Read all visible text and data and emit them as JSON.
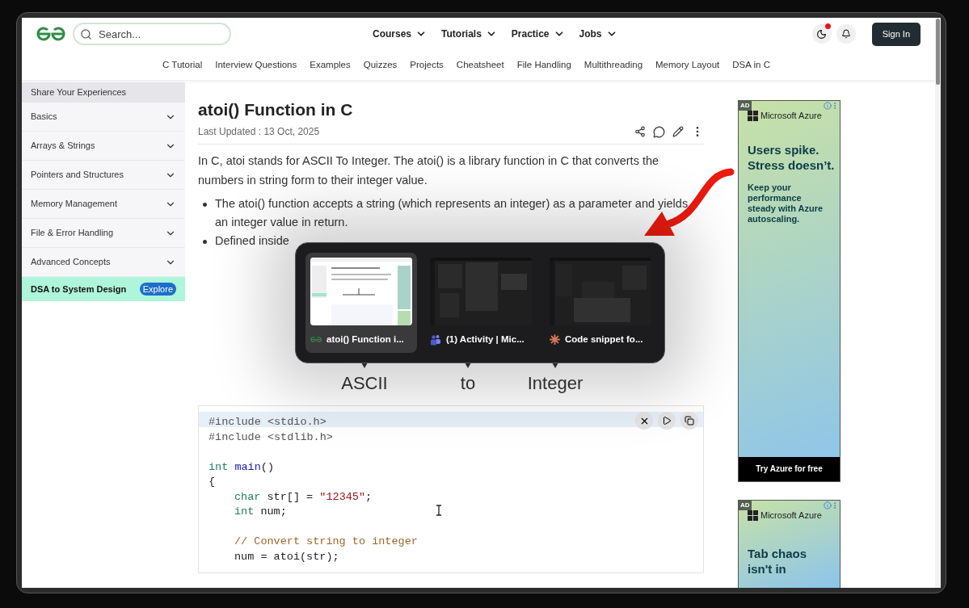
{
  "header": {
    "search": {
      "placeholder": "Search..."
    },
    "menus": [
      "Courses",
      "Tutorials",
      "Practice",
      "Jobs"
    ],
    "notification_dot": true,
    "sign_in": "Sign In"
  },
  "subnav": [
    "C Tutorial",
    "Interview Questions",
    "Examples",
    "Quizzes",
    "Projects",
    "Cheatsheet",
    "File Handling",
    "Multithreading",
    "Memory Layout",
    "DSA in C"
  ],
  "sidebar": {
    "heading": "Share Your Experiences",
    "items": [
      {
        "label": "Basics",
        "expanded": false
      },
      {
        "label": "Arrays & Strings",
        "expanded": false
      },
      {
        "label": "Pointers and Structures",
        "expanded": false
      },
      {
        "label": "Memory Management",
        "expanded": false
      },
      {
        "label": "File & Error Handling",
        "expanded": false
      },
      {
        "label": "Advanced Concepts",
        "expanded": false
      }
    ],
    "promo": {
      "label": "DSA to System Design",
      "button": "Explore"
    }
  },
  "article": {
    "title": "atoi() Function in C",
    "updated": "Last Updated : 13 Oct, 2025",
    "intro": "In C, atoi stands for ASCII To Integer. The atoi() is a library function in C that converts the numbers in string form to their integer value.",
    "bullets": [
      "The atoi() function accepts a string (which represents an integer) as a parameter and yields an integer value in return.",
      "Defined inside"
    ],
    "diagram_labels": [
      "ASCII",
      "to",
      "Integer"
    ],
    "code": {
      "lines": [
        {
          "kind": "code",
          "highlighted": true,
          "indented": false,
          "tokens": [
            {
              "kind": "preproc",
              "text": "#include <stdio.h>"
            }
          ]
        },
        {
          "kind": "code",
          "highlighted": false,
          "indented": false,
          "tokens": [
            {
              "kind": "preproc",
              "text": "#include <stdlib.h>"
            }
          ]
        },
        {
          "kind": "blank"
        },
        {
          "kind": "code",
          "highlighted": false,
          "indented": false,
          "tokens": [
            {
              "kind": "type",
              "text": "int "
            },
            {
              "kind": "func",
              "text": "main"
            },
            {
              "kind": "plain",
              "text": "()"
            }
          ]
        },
        {
          "kind": "code",
          "highlighted": false,
          "indented": false,
          "tokens": [
            {
              "kind": "plain",
              "text": "{"
            }
          ]
        },
        {
          "kind": "code",
          "highlighted": false,
          "indented": true,
          "tokens": [
            {
              "kind": "type",
              "text": "char"
            },
            {
              "kind": "plain",
              "text": " str[] = "
            },
            {
              "kind": "string",
              "text": "\"12345\""
            },
            {
              "kind": "plain",
              "text": ";"
            }
          ]
        },
        {
          "kind": "code",
          "highlighted": false,
          "indented": true,
          "tokens": [
            {
              "kind": "type",
              "text": "int"
            },
            {
              "kind": "plain",
              "text": " num;"
            }
          ]
        },
        {
          "kind": "blank"
        },
        {
          "kind": "code",
          "highlighted": false,
          "indented": true,
          "tokens": [
            {
              "kind": "comment",
              "text": "// Convert string to integer"
            }
          ]
        },
        {
          "kind": "code",
          "highlighted": false,
          "indented": true,
          "tokens": [
            {
              "kind": "plain",
              "text": "num = atoi(str);"
            }
          ]
        }
      ]
    }
  },
  "ads": [
    {
      "badge": "AD",
      "brand": "Microsoft Azure",
      "headline": [
        "Users spike.",
        "Stress doesn’t."
      ],
      "body": "Keep your performance steady with Azure autoscaling.",
      "cta": "Try Azure for free"
    },
    {
      "badge": "AD",
      "brand": "Microsoft Azure",
      "headline": [
        "Tab chaos",
        "isn't in"
      ]
    }
  ],
  "switcher": {
    "windows": [
      {
        "kind": "page",
        "title": "atoi() Function i...",
        "selected": true
      },
      {
        "kind": "chat",
        "title": "(1) Activity | Mic...",
        "selected": false
      },
      {
        "kind": "snippet",
        "title": "Code snippet fo...",
        "selected": false
      }
    ]
  }
}
